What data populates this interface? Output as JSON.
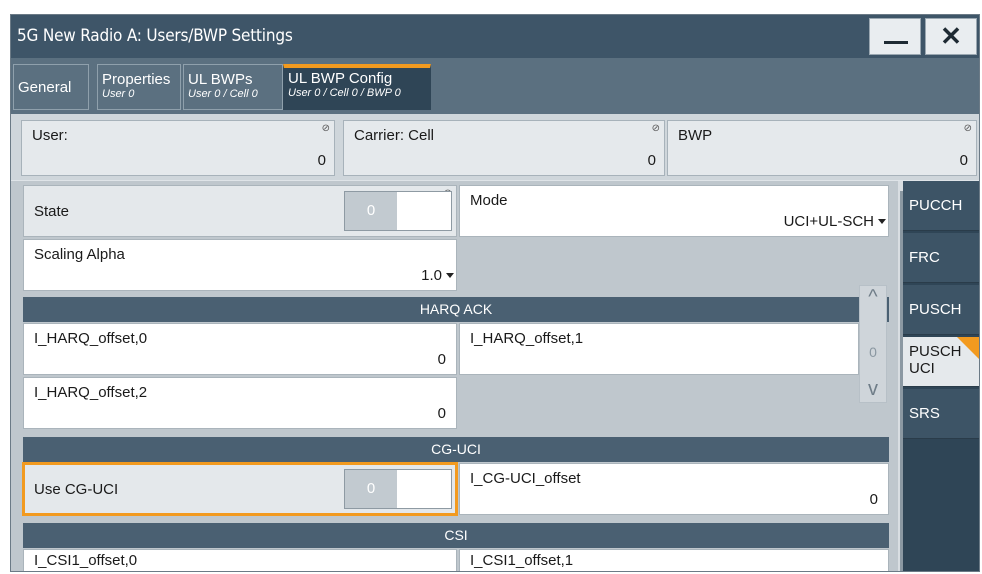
{
  "window": {
    "title": "5G New Radio A: Users/BWP Settings",
    "minimize_label": "minimize",
    "close_label": "close"
  },
  "tabs": [
    {
      "title": "General",
      "sub": ""
    },
    {
      "title": "Properties",
      "sub": "User 0"
    },
    {
      "title": "UL BWPs",
      "sub": "User 0 / Cell 0"
    },
    {
      "title": "UL BWP Config",
      "sub": "User 0 / Cell 0 / BWP 0"
    }
  ],
  "header": {
    "user": {
      "label": "User:",
      "value": "0"
    },
    "carrier": {
      "label": "Carrier: Cell",
      "value": "0"
    },
    "bwp": {
      "label": "BWP",
      "value": "0"
    }
  },
  "icons": {
    "lock": "⊘",
    "close": "✕",
    "up": "^",
    "down": "v"
  },
  "fields": {
    "state": {
      "label": "State",
      "value": "0"
    },
    "mode": {
      "label": "Mode",
      "value": "UCI+UL-SCH"
    },
    "scaling_alpha": {
      "label": "Scaling Alpha",
      "value": "1.0"
    },
    "harq0": {
      "label": "I_HARQ_offset,0",
      "value": "0"
    },
    "harq1": {
      "label": "I_HARQ_offset,1",
      "value": "0"
    },
    "harq2": {
      "label": "I_HARQ_offset,2",
      "value": "0"
    },
    "use_cg_uci": {
      "label": "Use CG-UCI",
      "value": "0"
    },
    "cg_uci_offset": {
      "label": "I_CG-UCI_offset",
      "value": "0"
    },
    "csi1_0": {
      "label": "I_CSI1_offset,0"
    },
    "csi1_1": {
      "label": "I_CSI1_offset,1"
    }
  },
  "sections": {
    "harq": "HARQ ACK",
    "cg_uci": "CG-UCI",
    "csi": "CSI"
  },
  "sidenav": [
    {
      "line1": "PUCCH",
      "line2": ""
    },
    {
      "line1": "FRC",
      "line2": ""
    },
    {
      "line1": "PUSCH",
      "line2": ""
    },
    {
      "line1": "PUSCH",
      "line2": "UCI"
    },
    {
      "line1": "SRS",
      "line2": ""
    }
  ],
  "colors": {
    "accent": "#f29a1f",
    "titlebar": "#3e5568",
    "section": "#4a6072"
  }
}
